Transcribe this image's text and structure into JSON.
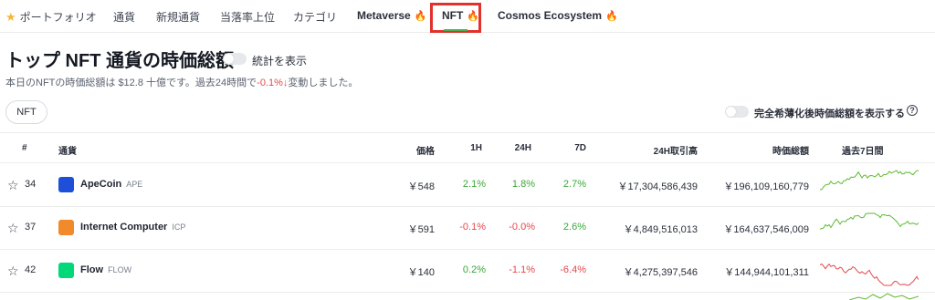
{
  "nav": {
    "items": [
      {
        "label": "ポートフォリオ",
        "star": true
      },
      {
        "label": "通貨"
      },
      {
        "label": "新規通貨"
      },
      {
        "label": "当落率上位"
      },
      {
        "label": "カテゴリ"
      },
      {
        "label": "Metaverse",
        "fire": true
      },
      {
        "label": "NFT",
        "fire": true,
        "active": true
      },
      {
        "label": "Cosmos Ecosystem",
        "fire": true
      }
    ]
  },
  "header": {
    "title": "トップ NFT 通貨の時価総額",
    "stats_toggle_label": "統計を表示",
    "subtitle_pre": "本日のNFTの時価総額は $12.8 十億です。過去24時間で",
    "subtitle_change": "-0.1%",
    "subtitle_arrow": "↓",
    "subtitle_post": "変動しました。"
  },
  "filters": {
    "pill_label": "NFT",
    "fdv_toggle_label": "完全希薄化後時価総額を表示する",
    "help_icon": "?"
  },
  "table": {
    "columns": {
      "rank": "#",
      "coin": "通貨",
      "price": "価格",
      "h1": "1H",
      "h24": "24H",
      "d7": "7D",
      "volume": "24H取引高",
      "mcap": "時価総額",
      "chart": "過去7日間"
    },
    "rows": [
      {
        "rank": "34",
        "name": "ApeCoin",
        "symbol": "APE",
        "price": "￥548",
        "h1": "2.1%",
        "h24": "1.8%",
        "d7": "2.7%",
        "volume": "￥17,304,586,439",
        "mcap": "￥196,109,160,779",
        "icon_color": "#1d4fd8",
        "trend_color": "#5dba2f"
      },
      {
        "rank": "37",
        "name": "Internet Computer",
        "symbol": "ICP",
        "price": "￥591",
        "h1": "-0.1%",
        "h24": "-0.0%",
        "d7": "2.6%",
        "volume": "￥4,849,516,013",
        "mcap": "￥164,637,546,009",
        "icon_color": "#f08a2a",
        "trend_color": "#5dba2f"
      },
      {
        "rank": "42",
        "name": "Flow",
        "symbol": "FLOW",
        "price": "￥140",
        "h1": "0.2%",
        "h24": "-1.1%",
        "d7": "-6.4%",
        "volume": "￥4,275,397,546",
        "mcap": "￥144,944,101,311",
        "icon_color": "#00d87a",
        "trend_color": "#e5484d"
      }
    ]
  }
}
